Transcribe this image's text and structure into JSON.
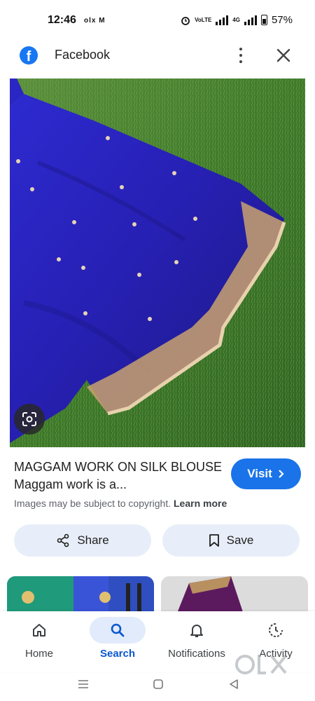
{
  "status_bar": {
    "time": "12:46",
    "app_icons": "olx M",
    "net_label_1": "VoLTE",
    "net_label_2": "4G",
    "battery": "57%"
  },
  "header": {
    "site_name": "Facebook",
    "logo_letter": "f"
  },
  "result": {
    "title": "MAGGAM WORK ON SILK BLOUSE Maggam work is a...",
    "visit_label": "Visit",
    "copyright_text": "Images may be subject to copyright.",
    "learn_more": "Learn more",
    "share_label": "Share",
    "save_label": "Save"
  },
  "bottom_nav": {
    "items": [
      {
        "label": "Home",
        "icon": "home-icon"
      },
      {
        "label": "Search",
        "icon": "search-icon"
      },
      {
        "label": "Notifications",
        "icon": "bell-icon"
      },
      {
        "label": "Activity",
        "icon": "activity-icon"
      }
    ],
    "active_index": 1
  },
  "colors": {
    "accent": "#1a73e8",
    "facebook": "#1877f2",
    "blouse": "#2a23b8",
    "grass": "#3f7a2c"
  }
}
